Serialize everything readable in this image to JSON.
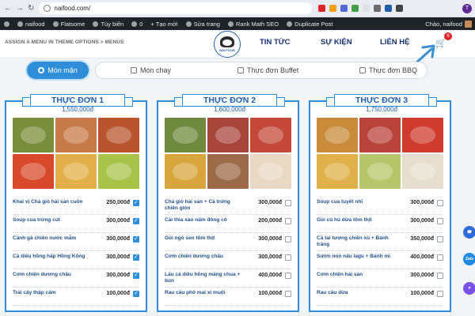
{
  "browser": {
    "url": "naifood.com/",
    "extension_icons": [
      "#e3242b",
      "#f3a01b",
      "#5566d6",
      "#43a047",
      "#e0e0e0",
      "#6b6b6b",
      "#1f5fa8",
      "#444"
    ],
    "profile_initial": "T"
  },
  "wpbar": {
    "site": "naifood",
    "theme": "Flatsome",
    "customize": "Tùy biến",
    "comments": "0",
    "new": "+ Tạo mới",
    "edit": "Sửa trang",
    "seo": "Rank Math SEO",
    "duplicate": "Duplicate Post",
    "greeting": "Chào, naifood"
  },
  "header": {
    "assign": "ASSIGN A MENU IN THEME OPTIONS > MENUS",
    "logo_text": "NAI FOOD",
    "nav": [
      "TIN TỨC",
      "SỰ KIỆN",
      "LIÊN HỆ"
    ],
    "cart_count": "6"
  },
  "tabs": [
    "Món mặn",
    "Món chay",
    "Thực đơn Buffet",
    "Thực đơn BBQ"
  ],
  "menus": [
    {
      "title": "THỰC ĐƠN 1",
      "price": "1,550,000đ",
      "photo_colors": [
        "#7a8d3a",
        "#c77a4a",
        "#b8542e",
        "#d84a2b",
        "#e2b04a",
        "#a8c24a"
      ],
      "items": [
        {
          "name": "Khai vị Chả giò hải sản cuốn",
          "price": "250,000đ",
          "checked": true
        },
        {
          "name": "Soup cua trứng cút",
          "price": "300,000đ",
          "checked": true
        },
        {
          "name": "Cánh gà chiên nước mắm",
          "price": "300,000đ",
          "checked": true
        },
        {
          "name": "Cá diêu hồng hấp Hồng Kông",
          "price": "300,000đ",
          "checked": true
        },
        {
          "name": "Cơm chiên dương châu",
          "price": "300,000đ",
          "checked": true
        },
        {
          "name": "Trái cây thập cẩm",
          "price": "100,000đ",
          "checked": true
        }
      ]
    },
    {
      "title": "THỰC ĐƠN 2",
      "price": "1,600,000đ",
      "photo_colors": [
        "#6f8a3e",
        "#a9463b",
        "#c4483a",
        "#d9a63e",
        "#9b6a48",
        "#e9d8c4"
      ],
      "items": [
        {
          "name": "Chả giò hải sản + Cá trứng chiên giòn",
          "price": "300,000đ",
          "checked": false
        },
        {
          "name": "Cải thìa xào nấm đông cô",
          "price": "200,000đ",
          "checked": false
        },
        {
          "name": "Gỏi ngó sen tôm thịt",
          "price": "300,000đ",
          "checked": false
        },
        {
          "name": "Cơm chiên dương châu",
          "price": "300,000đ",
          "checked": false
        },
        {
          "name": "Lẩu cá diêu hồng măng chua + bún",
          "price": "400,000đ",
          "checked": false
        },
        {
          "name": "Rau câu phô mai xí muội",
          "price": "100,000đ",
          "checked": false
        }
      ]
    },
    {
      "title": "THỰC ĐƠN 3",
      "price": "1,750,000đ",
      "photo_colors": [
        "#c98a3a",
        "#b8433a",
        "#cf3b2e",
        "#e0b14a",
        "#b7c66a",
        "#e6dfcf"
      ],
      "items": [
        {
          "name": "Soup cua tuyết nhĩ",
          "price": "300,000đ",
          "checked": false
        },
        {
          "name": "Gỏi củ hủ dừa tôm thịt",
          "price": "300,000đ",
          "checked": false
        },
        {
          "name": "Cá tai tượng chiên xù + Bánh tráng",
          "price": "350,000đ",
          "checked": false
        },
        {
          "name": "Sườn non nấu lagu + Bánh mì",
          "price": "400,000đ",
          "checked": false
        },
        {
          "name": "Cơm chiên hải sản",
          "price": "300,000đ",
          "checked": false
        },
        {
          "name": "Rau câu dừa",
          "price": "100,000đ",
          "checked": false
        }
      ]
    }
  ],
  "floats": [
    {
      "label": "",
      "color": "#2d6bd8"
    },
    {
      "label": "Zalo",
      "color": "#1e88e5"
    },
    {
      "label": "",
      "color": "#7b52e8"
    }
  ],
  "accent": "#2e8fd8"
}
